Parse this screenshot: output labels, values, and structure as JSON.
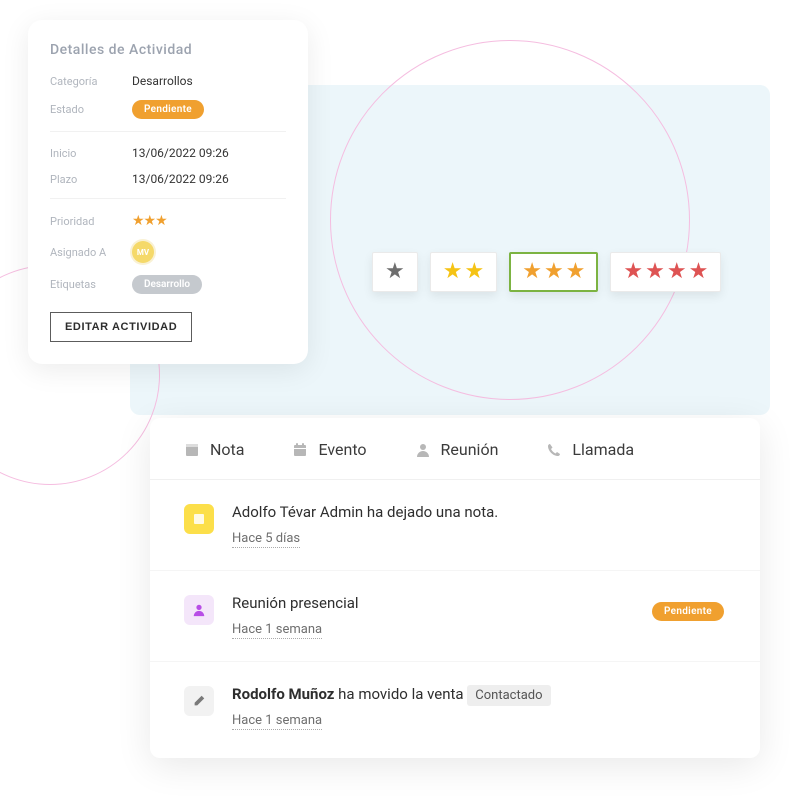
{
  "details": {
    "title": "Detalles de Actividad",
    "category_label": "Categoría",
    "category_value": "Desarrollos",
    "status_label": "Estado",
    "status_value": "Pendiente",
    "start_label": "Inicio",
    "start_value": "13/06/2022 09:26",
    "deadline_label": "Plazo",
    "deadline_value": "13/06/2022 09:26",
    "priority_label": "Prioridad",
    "priority_stars": "★★★",
    "assigned_label": "Asignado A",
    "assigned_initials": "MV",
    "tags_label": "Etiquetas",
    "tag_value": "Desarrollo",
    "edit_button": "EDITAR ACTIVIDAD"
  },
  "ratings": [
    {
      "stars": 1,
      "color": "gray",
      "selected": false
    },
    {
      "stars": 2,
      "color": "yellow",
      "selected": false
    },
    {
      "stars": 3,
      "color": "orange",
      "selected": true
    },
    {
      "stars": 4,
      "color": "red",
      "selected": false
    }
  ],
  "tabs": [
    {
      "label": "Nota",
      "icon": "note-icon"
    },
    {
      "label": "Evento",
      "icon": "calendar-icon"
    },
    {
      "label": "Reunión",
      "icon": "person-icon"
    },
    {
      "label": "Llamada",
      "icon": "phone-icon"
    }
  ],
  "feed": [
    {
      "icon": "note",
      "text": "Adolfo Tévar Admin ha dejado una nota.",
      "time": "Hace 5 días",
      "badge": null
    },
    {
      "icon": "meeting",
      "text": "Reunión presencial",
      "time": "Hace 1 semana",
      "badge": "Pendiente"
    },
    {
      "icon": "edit",
      "actor": "Rodolfo Muñoz",
      "action": " ha movido la venta ",
      "chip": "Contactado",
      "time": "Hace 1 semana",
      "badge": null
    }
  ]
}
